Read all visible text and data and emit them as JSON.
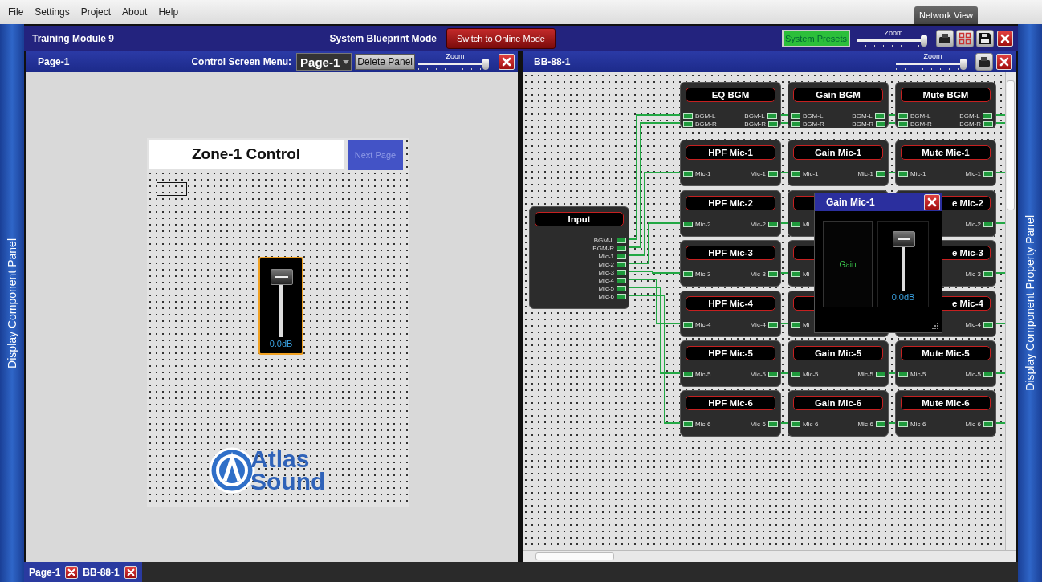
{
  "menu_bar": {
    "items": [
      "File",
      "Settings",
      "Project",
      "About",
      "Help"
    ],
    "network_view_tab": "Network View"
  },
  "project_bar": {
    "title": "Training Module 9",
    "mode": "System Blueprint Mode",
    "mode_button": "Switch to Online Mode",
    "presets_button": "System Presets",
    "zoom": {
      "label": "Zoom",
      "level": 0.95
    }
  },
  "side_panels": {
    "left": "Display Component Panel",
    "right": "Display Component Property Panel"
  },
  "control_panel": {
    "title": "Page-1",
    "menu_label": "Control Screen Menu:",
    "page_select": "Page-1",
    "delete_button": "Delete Panel",
    "zoom": {
      "label": "Zoom",
      "level": 0.95
    },
    "canvas": {
      "label": "Zone-1 Control",
      "next_button": "Next Page",
      "fader": {
        "level": 0.9,
        "reading": "0.0dB"
      },
      "logo": [
        "Atlas",
        "Sound"
      ]
    }
  },
  "blueprint_panel": {
    "title": "BB-88-1",
    "zoom": {
      "label": "Zoom",
      "level": 0.95
    },
    "input_block": {
      "title": "Input",
      "ports": [
        "BGM-L",
        "BGM-R",
        "Mic-1",
        "Mic-2",
        "Mic-3",
        "Mic-4",
        "Mic-5",
        "Mic-6"
      ]
    },
    "blocks": [
      {
        "title": "EQ BGM",
        "in_ports": [
          "BGM-L",
          "BGM-R"
        ],
        "out_ports": [
          "BGM-L",
          "BGM-R"
        ]
      },
      {
        "title": "Gain BGM",
        "in_ports": [
          "BGM-L",
          "BGM-R"
        ],
        "out_ports": [
          "BGM-L",
          "BGM-R"
        ]
      },
      {
        "title": "Mute BGM",
        "in_ports": [
          "BGM-L",
          "BGM-R"
        ],
        "out_ports": [
          "BGM-L",
          "BGM-R"
        ]
      },
      {
        "title": "HPF Mic-1",
        "in_ports": [
          "Mic-1"
        ],
        "out_ports": [
          "Mic-1"
        ]
      },
      {
        "title": "Gain Mic-1",
        "in_ports": [
          "Mic-1"
        ],
        "out_ports": [
          "Mic-1"
        ]
      },
      {
        "title": "Mute Mic-1",
        "in_ports": [
          "Mic-1"
        ],
        "out_ports": [
          "Mic-1"
        ]
      },
      {
        "title": "HPF Mic-2",
        "in_ports": [
          "Mic-2"
        ],
        "out_ports": [
          "Mic-2"
        ]
      },
      {
        "in_ports": [
          "Mi"
        ]
      },
      {
        "title": "e Mic-2",
        "out_ports": [
          "Mic-2"
        ]
      },
      {
        "title": "HPF Mic-3",
        "in_ports": [
          "Mic-3"
        ],
        "out_ports": [
          "Mic-3"
        ]
      },
      {
        "in_ports": [
          "Mi"
        ]
      },
      {
        "title": "e Mic-3",
        "out_ports": [
          "Mic-3"
        ]
      },
      {
        "title": "HPF Mic-4",
        "in_ports": [
          "Mic-4"
        ],
        "out_ports": [
          "Mic-4"
        ]
      },
      {
        "in_ports": [
          "Mi"
        ]
      },
      {
        "title": "e Mic-4",
        "out_ports": [
          "Mic-4"
        ]
      },
      {
        "title": "HPF Mic-5",
        "in_ports": [
          "Mic-5"
        ],
        "out_ports": [
          "Mic-5"
        ]
      },
      {
        "title": "Gain Mic-5",
        "in_ports": [
          "Mic-5"
        ],
        "out_ports": [
          "Mic-5"
        ]
      },
      {
        "title": "Mute Mic-5",
        "in_ports": [
          "Mic-5"
        ],
        "out_ports": [
          "Mic-5"
        ]
      },
      {
        "title": "HPF Mic-6",
        "in_ports": [
          "Mic-6"
        ],
        "out_ports": [
          "Mic-6"
        ]
      },
      {
        "title": "Gain Mic-6",
        "in_ports": [
          "Mic-6"
        ],
        "out_ports": [
          "Mic-6"
        ]
      },
      {
        "title": "Mute Mic-6",
        "in_ports": [
          "Mic-6"
        ],
        "out_ports": [
          "Mic-6"
        ]
      }
    ],
    "popup": {
      "title": "Gain Mic-1",
      "label": "Gain",
      "fader": {
        "level": 0.9,
        "reading": "0.0dB"
      }
    }
  },
  "open_tabs": [
    {
      "label": "Page-1"
    },
    {
      "label": "BB-88-1"
    }
  ]
}
